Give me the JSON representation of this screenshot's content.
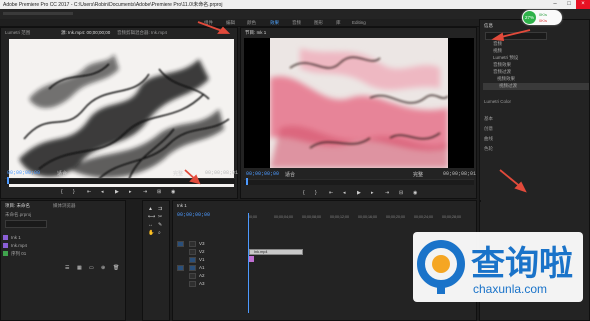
{
  "titlebar": {
    "title": "Adobe Premiere Pro CC 2017 - C:\\Users\\Robin\\Documents\\Adobe\\Premiere Pro\\11.0\\未命名.prproj"
  },
  "workspaces": [
    "组件",
    "编辑",
    "颜色",
    "效果",
    "音频",
    "图形",
    "库",
    "Editing"
  ],
  "source_monitor": {
    "tabs": [
      "Lumetri 范围",
      "源: Ink.mp4: 00;00;00;00",
      "效果控件",
      "音频剪辑混合器: Ink.mp4"
    ],
    "timecode": "00;00;00;00",
    "fit": "适合",
    "scale": "完整",
    "duration": "00;00;08;01"
  },
  "program_monitor": {
    "tab": "节目: Ink 1",
    "timecode": "00;00;00;00",
    "fit": "适合",
    "scale": "完整",
    "duration": "00;00;08;01"
  },
  "project_panel": {
    "tabs": [
      "项目: 未命名",
      "媒体浏览器"
    ],
    "project_file": "未命名.prproj",
    "items": [
      "Ink 1",
      "Ink.mp4",
      "序列 01"
    ]
  },
  "timeline": {
    "tab": "Ink 1",
    "timecode": "00;00;00;00",
    "ruler": [
      "00;00",
      "00;00;04;00",
      "00;00;08;00",
      "00;00;12;00",
      "00;00;16;00",
      "00;00;20;00",
      "00;00;24;00",
      "00;00;28;00"
    ],
    "tracks": [
      "V3",
      "V2",
      "V1",
      "A1",
      "A2",
      "A3"
    ],
    "clip": "Ink.mp4"
  },
  "right_panel": {
    "tab": "信息",
    "tree": [
      "音频",
      "视频",
      "Lumetri 预设",
      "音频效果",
      "音频过渡",
      "视频效果",
      "视频过渡"
    ],
    "sections": [
      "Lumetri Color",
      "基本",
      "创意",
      "曲线",
      "色轮"
    ],
    "percent": "27%",
    "upload": "0K/s",
    "download": "0K/s"
  },
  "watermark": {
    "cn": "查询啦",
    "en": "chaxunla.com"
  },
  "colors": {
    "accent": "#4d9aff",
    "arrow": "#e24a3b",
    "watermark_blue": "#1a73c9"
  }
}
